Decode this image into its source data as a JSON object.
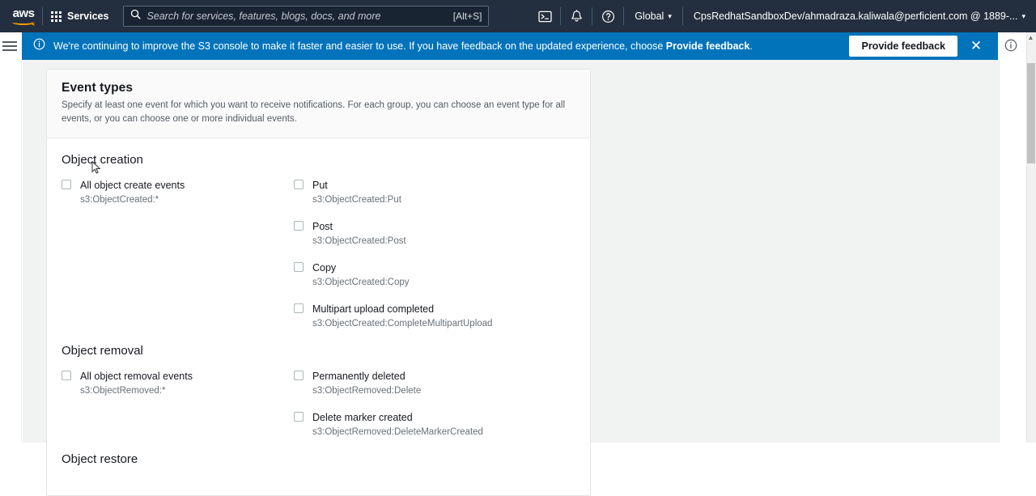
{
  "top_nav": {
    "logo": "aws",
    "services_label": "Services",
    "waffle_icon": "app-grid-icon",
    "search": {
      "icon": "search-icon",
      "placeholder": "Search for services, features, blogs, docs, and more",
      "value": "",
      "shortcut": "[Alt+S]"
    },
    "cloudshell_icon": "cloudshell-terminal-icon",
    "notifications_icon": "bell-icon",
    "help_icon": "question-circle-icon",
    "region_label": "Global",
    "account_label": "CpsRedhatSandboxDev/ahmadraza.kaliwala@perficient.com @ 1889-...",
    "caret": "▾"
  },
  "banner": {
    "info_icon": "info-circle-icon",
    "text_part1": "We're continuing to improve the S3 console to make it faster and easier to use. If you have feedback on the updated experience, choose ",
    "text_bold": "Provide feedback",
    "text_part3": ".",
    "button_label": "Provide feedback",
    "close_icon": "close-icon",
    "close_glyph": "✕",
    "accent_color": "#0073bb"
  },
  "sidebar_toggle": {
    "icon": "hamburger-menu-icon"
  },
  "right_panel": {
    "info_icon": "info-circle-icon"
  },
  "card": {
    "title": "Event types",
    "description": "Specify at least one event for which you want to receive notifications. For each group, you can choose an event type for all events, or you can choose one or more individual events.",
    "groups": [
      {
        "name": "object-creation",
        "title": "Object creation",
        "left_options": [
          {
            "label": "All object create events",
            "sub": "s3:ObjectCreated:*",
            "checked": false
          }
        ],
        "right_options": [
          {
            "label": "Put",
            "sub": "s3:ObjectCreated:Put",
            "checked": false
          },
          {
            "label": "Post",
            "sub": "s3:ObjectCreated:Post",
            "checked": false
          },
          {
            "label": "Copy",
            "sub": "s3:ObjectCreated:Copy",
            "checked": false
          },
          {
            "label": "Multipart upload completed",
            "sub": "s3:ObjectCreated:CompleteMultipartUpload",
            "checked": false
          }
        ]
      },
      {
        "name": "object-removal",
        "title": "Object removal",
        "left_options": [
          {
            "label": "All object removal events",
            "sub": "s3:ObjectRemoved:*",
            "checked": false
          }
        ],
        "right_options": [
          {
            "label": "Permanently deleted",
            "sub": "s3:ObjectRemoved:Delete",
            "checked": false
          },
          {
            "label": "Delete marker created",
            "sub": "s3:ObjectRemoved:DeleteMarkerCreated",
            "checked": false
          }
        ]
      },
      {
        "name": "object-restore",
        "title": "Object restore",
        "left_options": [],
        "right_options": []
      }
    ]
  },
  "scrollbar": {
    "arrow_up_glyph": "▲"
  },
  "colors": {
    "nav_background": "#232f3e",
    "banner_blue": "#0073bb",
    "aws_orange": "#ff9900",
    "page_background": "#f1f3f3",
    "card_background": "#ffffff",
    "text_primary": "#16191f",
    "text_secondary": "#545b64"
  }
}
